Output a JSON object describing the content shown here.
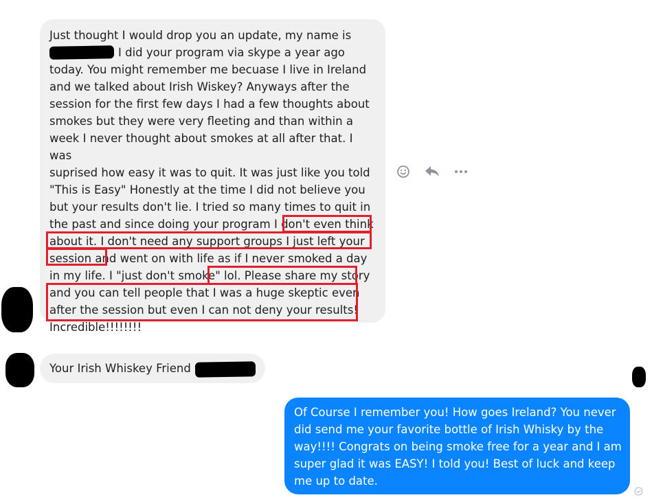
{
  "messages": [
    {
      "sender": "contact",
      "lines": [
        "Just thought I would drop you an update, my name is",
        "I did your program via skype a year ago",
        "today. You might remember me becuase I live in Ireland",
        "and we talked about Irish Wiskey? Anyways after the",
        "session for the first few days I had a few thoughts about",
        "smokes but they were very fleeting and than within a",
        "week I never thought about smokes at all after that. I was",
        "suprised how easy it was to quit. It was just like you told",
        "\"This is Easy\" Honestly at the time I did not believe you",
        "but your results don't lie. I tried so many times to quit in",
        "the past and since doing your program I don't even think",
        "about it. I don't need any support groups I just left your",
        "session and went on with life as if I never smoked a day",
        "in my life. I \"just don't smoke\" lol. Please share my story",
        "and you can tell people that I was a huge skeptic even",
        "after the session but even I can not deny your results!",
        "Incredible!!!!!!!!"
      ]
    },
    {
      "sender": "contact",
      "text": "Your Irish Whiskey Friend"
    },
    {
      "sender": "me",
      "lines": [
        "Of Course I remember you! How goes Ireland? You never",
        "did send me your favorite bottle of Irish Whisky by the",
        "way!!!! Congrats on being smoke free for a year and I am",
        "super glad it was EASY! I told you!  Best of luck and keep",
        "me up to date."
      ]
    }
  ],
  "actions": [
    "smiley-icon",
    "reply-icon",
    "more-icon"
  ],
  "colors": {
    "incoming_bubble": "#f1f0f0",
    "outgoing_bubble": "#0b84ff",
    "highlight_box": "#e0202a"
  }
}
